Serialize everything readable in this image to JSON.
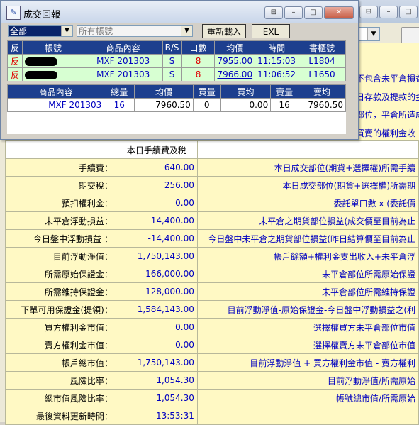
{
  "background": {
    "notes": [
      "不包含未平倉損益",
      "日存款及提款的金",
      "部位，平倉所造成",
      "買賣的權利金收"
    ],
    "header_col2": "本日手續費及稅",
    "rows": [
      {
        "label": "手續費：",
        "value": "640.00",
        "desc": "本日成交部位(期貨+選擇權)所需手續"
      },
      {
        "label": "期交稅：",
        "value": "256.00",
        "desc": "本日成交部位(期貨+選擇權)所需期"
      },
      {
        "label": "預扣權利金：",
        "value": "0.00",
        "desc": "委託單口數 x (委託價"
      },
      {
        "label": "未平倉浮動損益：",
        "value": "-14,400.00",
        "desc": "未平倉之期貨部位損益(成交價至目前為止"
      },
      {
        "label": "今日盤中浮動損益 ：",
        "value": "-14,400.00",
        "desc": "今日盤中未平倉之期貨部位損益(昨日結算價至目前為止"
      },
      {
        "label": "目前浮動淨值：",
        "value": "1,750,143.00",
        "desc": "帳戶餘額+權利金支出收入+未平倉浮"
      },
      {
        "label": "所需原始保證金：",
        "value": "166,000.00",
        "desc": "未平倉部位所需原始保證"
      },
      {
        "label": "所需維持保證金：",
        "value": "128,000.00",
        "desc": "未平倉部位所需維持保證"
      },
      {
        "label": "下單可用保證金(提領)：",
        "value": "1,584,143.00",
        "desc": "目前浮動淨值-原始保證金-今日盤中浮動損益之(利"
      },
      {
        "label": "買方權利金市值：",
        "value": "0.00",
        "desc": "選擇權買方未平倉部位市值"
      },
      {
        "label": "賣方權利金市值：",
        "value": "0.00",
        "desc": "選擇權賣方未平倉部位市值"
      },
      {
        "label": "帳戶總市值：",
        "value": "1,750,143.00",
        "desc": "目前浮動淨值 + 買方權利金市值 - 賣方權利"
      },
      {
        "label": "風險比率：",
        "value": "1,054.30",
        "desc": "目前浮動淨值/所需原始"
      },
      {
        "label": "總市值風險比率：",
        "value": "1,054.30",
        "desc": "帳號總市值/所需原始"
      },
      {
        "label": "最後資料更新時間：",
        "value": "13:53:31",
        "desc": ""
      }
    ]
  },
  "dialog": {
    "title": "成交回報",
    "icon_glyph": "✎",
    "filter_all": "全部",
    "filter_account_placeholder": "所有帳號",
    "reload_label": "重新載入",
    "exl_label": "EXL",
    "trades_headers": [
      "反",
      "帳號",
      "商品內容",
      "B/S",
      "口數",
      "均價",
      "時間",
      "書櫃號"
    ],
    "trades": [
      {
        "rev": "反",
        "product": "MXF 201303",
        "bs": "S",
        "qty": "8",
        "price": "7955.00",
        "time": "11:15:03",
        "book": "L1804"
      },
      {
        "rev": "反",
        "product": "MXF 201303",
        "bs": "S",
        "qty": "8",
        "price": "7966.00",
        "time": "11:06:52",
        "book": "L1650"
      }
    ],
    "summary_headers": [
      "商品內容",
      "總量",
      "均價",
      "買量",
      "買均",
      "賣量",
      "賣均"
    ],
    "summary": [
      {
        "product": "MXF 201303",
        "total": "16",
        "avg": "7960.50",
        "buy_qty": "0",
        "buy_avg": "0.00",
        "sell_qty": "16",
        "sell_avg": "7960.50"
      }
    ]
  }
}
